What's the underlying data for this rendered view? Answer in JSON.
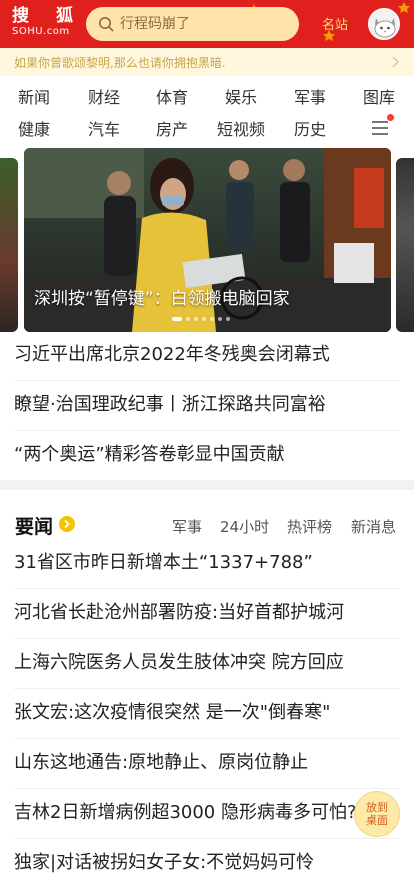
{
  "header": {
    "logo_cn": [
      "搜",
      "狐"
    ],
    "logo_en": "SOHU.com",
    "search_placeholder": "行程码崩了",
    "mingzhan": "名站",
    "colors": {
      "header_bg": "#e0201c",
      "search_bg": "#ffe3a8",
      "accent": "#ffd97a"
    }
  },
  "slogan": {
    "text": "如果你曾歌颂黎明,那么也请你拥抱黑暗."
  },
  "channels": {
    "row1": [
      "新闻",
      "财经",
      "体育",
      "娱乐",
      "军事",
      "图库"
    ],
    "row2": [
      "健康",
      "汽车",
      "房产",
      "短视频",
      "历史"
    ]
  },
  "carousel": {
    "caption": "深圳按“暂停键”：白领搬电脑回家",
    "dot_count": 7,
    "active_dot": 0
  },
  "headlines": [
    "习近平出席北京2022年冬残奥会闭幕式",
    "瞭望·治国理政纪事丨浙江探路共同富裕",
    "“两个奥运”精彩答卷彰显中国贡献"
  ],
  "section": {
    "title": "要闻",
    "tabs": [
      "军事",
      "24小时",
      "热评榜",
      "新消息"
    ]
  },
  "news": [
    "31省区市昨日新增本土“1337+788”",
    "河北省长赴沧州部署防疫:当好首都护城河",
    "上海六院医务人员发生肢体冲突 院方回应",
    "张文宏:这次疫情很突然 是一次\"倒春寒\"",
    "山东这地通告:原地静止、原岗位静止",
    "吉林2日新增病例超3000 隐形病毒多可怕?",
    "独家|对话被拐妇女子女:不觉妈妈可怜"
  ],
  "float_button": {
    "line1": "放到",
    "line2": "桌面"
  }
}
